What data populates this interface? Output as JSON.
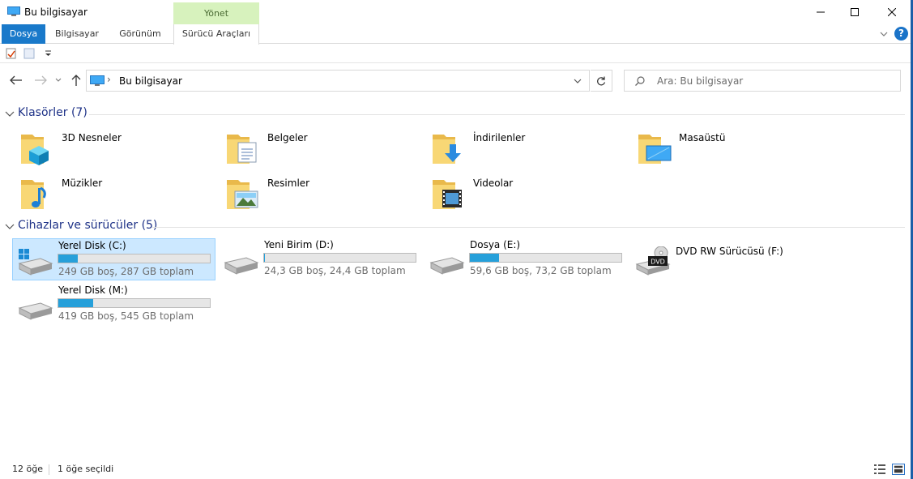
{
  "window": {
    "title": "Bu bilgisayar",
    "contextual_tab_group": "Yönet"
  },
  "ribbon": {
    "tabs": [
      {
        "label": "Dosya"
      },
      {
        "label": "Bilgisayar"
      },
      {
        "label": "Görünüm"
      },
      {
        "label": "Sürücü Araçları"
      }
    ],
    "help": "?"
  },
  "address_bar": {
    "separator": "›",
    "path": "Bu bilgisayar"
  },
  "search": {
    "placeholder": "Ara: Bu bilgisayar"
  },
  "folders_section": {
    "title": "Klasörler (7)",
    "items": [
      {
        "label": "3D Nesneler",
        "icon": "3d-objects-folder-icon"
      },
      {
        "label": "Belgeler",
        "icon": "documents-folder-icon"
      },
      {
        "label": "İndirilenler",
        "icon": "downloads-folder-icon"
      },
      {
        "label": "Masaüstü",
        "icon": "desktop-folder-icon"
      },
      {
        "label": "Müzikler",
        "icon": "music-folder-icon"
      },
      {
        "label": "Resimler",
        "icon": "pictures-folder-icon"
      },
      {
        "label": "Videolar",
        "icon": "videos-folder-icon"
      }
    ]
  },
  "drives_section": {
    "title": "Cihazlar ve sürücüler (5)",
    "items": [
      {
        "name": "Yerel Disk (C:)",
        "info": "249 GB boş, 287 GB toplam",
        "used_percent": 13,
        "selected": true
      },
      {
        "name": "Yeni Birim (D:)",
        "info": "24,3 GB boş, 24,4 GB toplam",
        "used_percent": 0.4,
        "selected": false
      },
      {
        "name": "Dosya (E:)",
        "info": "59,6 GB boş, 73,2 GB toplam",
        "used_percent": 19,
        "selected": false
      },
      {
        "name": "DVD RW Sürücüsü (F:)",
        "info": "",
        "selected": false,
        "dvd_badge": "DVD"
      },
      {
        "name": "Yerel Disk (M:)",
        "info": "419 GB boş, 545 GB toplam",
        "used_percent": 23,
        "selected": false
      }
    ]
  },
  "status_bar": {
    "item_count": "12 öğe",
    "selected_count": "1 öğe seçildi"
  },
  "colors": {
    "accent": "#1979ca",
    "manage_tab": "#d7f2bd",
    "selection": "#cce8ff",
    "drive_fill": "#26a0da",
    "section_title": "#1e3287"
  }
}
